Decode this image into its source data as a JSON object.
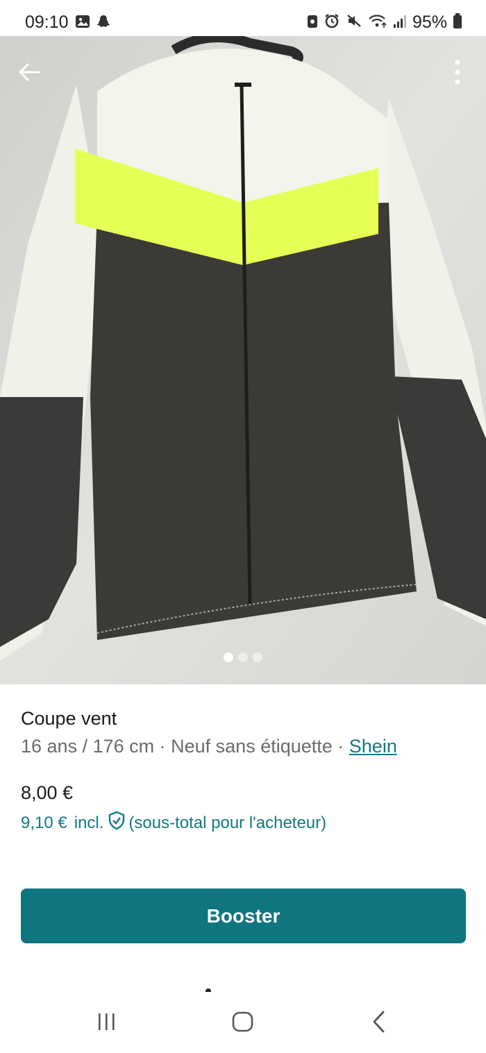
{
  "status_bar": {
    "time": "09:10",
    "left_icons": [
      "gallery-icon",
      "snapchat-icon"
    ],
    "right_icons": [
      "vpn-key-icon",
      "alarm-icon",
      "mute-icon",
      "wifi-icon",
      "signal-icon",
      "battery-icon"
    ],
    "battery": "95%"
  },
  "photo": {
    "image_count": 3,
    "active_index": 0
  },
  "item": {
    "title": "Coupe vent",
    "size": "16 ans / 176 cm",
    "separator1": " · ",
    "condition": "Neuf sans étiquette",
    "separator2": " · ",
    "brand": "Shein"
  },
  "pricing": {
    "price": "8,00 €",
    "total_price": "9,10 €",
    "incl_label": "incl.",
    "buyer_note": "(sous-total pour l'acheteur)"
  },
  "actions": {
    "booster_label": "Booster"
  },
  "colors": {
    "accent": "#0f7680",
    "link": "#117a82",
    "muted_text": "#6b6b6b"
  }
}
